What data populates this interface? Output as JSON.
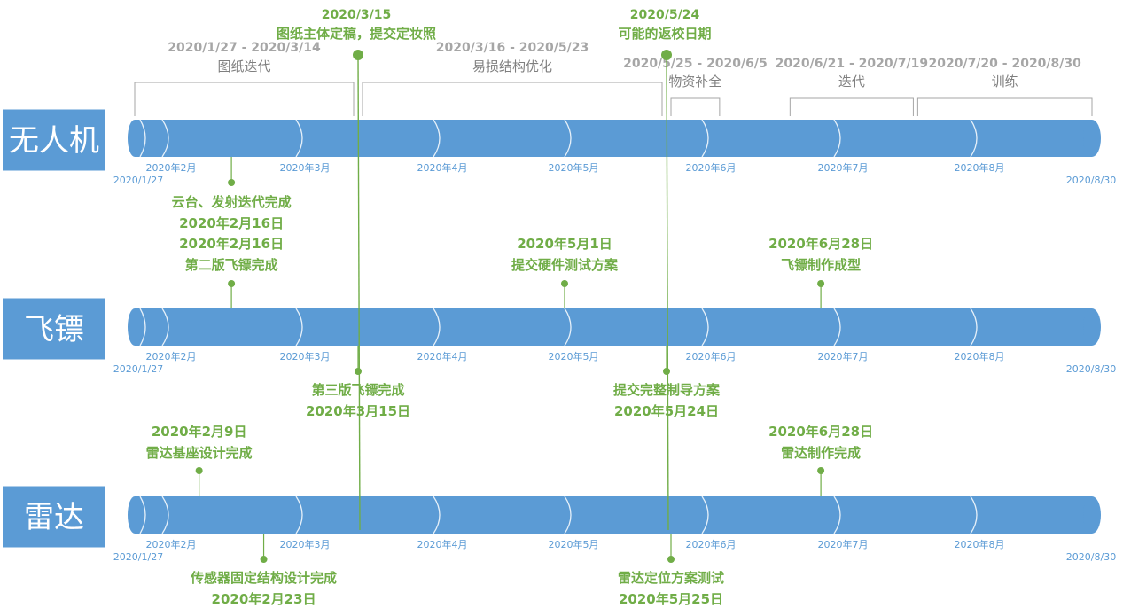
{
  "colors": {
    "bar": "#5b9bd5",
    "bar_edge": "#ffffff",
    "label_box": "#5b9bd5",
    "label_text": "#ffffff",
    "tick_text": "#5b9bd5",
    "milestone": "#70ad47",
    "milestone_text": "#70ad47",
    "phase_text": "#a6a6a6",
    "phase_bracket": "#a6a6a6",
    "phase_title": "#7f7f7f"
  },
  "timeline": {
    "start_label": "2020/1/27",
    "end_label": "2020/8/30",
    "month_labels": [
      "2020年2月",
      "2020年3月",
      "2020年4月",
      "2020年5月",
      "2020年6月",
      "2020年7月",
      "2020年8月"
    ]
  },
  "tracks": [
    {
      "id": "uav",
      "label": "无人机"
    },
    {
      "id": "dart",
      "label": "飞镖"
    },
    {
      "id": "radar",
      "label": "雷达"
    }
  ],
  "phases": [
    {
      "dates": "2020/1/27 - 2020/3/14",
      "name": "图纸迭代"
    },
    {
      "dates": "2020/3/16 - 2020/5/23",
      "name": "易损结构优化"
    },
    {
      "dates": "2020/5/25 - 2020/6/5",
      "name": "物资补全"
    },
    {
      "dates": "2020/6/21 - 2020/7/19",
      "name": "迭代"
    },
    {
      "dates": "2020/7/20 - 2020/8/30",
      "name": "训练"
    }
  ],
  "global_milestones": [
    {
      "date": "2020/3/15",
      "text": "图纸主体定稿，提交定妆照"
    },
    {
      "date": "2020/5/24",
      "text": "可能的返校日期"
    }
  ],
  "milestones": [
    {
      "track": "uav",
      "line1": "云台、发射迭代完成",
      "line2": "2020年2月16日"
    },
    {
      "track": "dart",
      "line1": "2020年2月16日",
      "line2": "第二版飞镖完成"
    },
    {
      "track": "dart",
      "line1": "2020年5月1日",
      "line2": "提交硬件测试方案"
    },
    {
      "track": "dart",
      "line1": "2020年6月28日",
      "line2": "飞镖制作成型"
    },
    {
      "track": "dart",
      "line1": "第三版飞镖完成",
      "line2": "2020年3月15日"
    },
    {
      "track": "dart",
      "line1": "提交完整制导方案",
      "line2": "2020年5月24日"
    },
    {
      "track": "radar",
      "line1": "2020年2月9日",
      "line2": "雷达基座设计完成"
    },
    {
      "track": "radar",
      "line1": "2020年6月28日",
      "line2": "雷达制作完成"
    },
    {
      "track": "radar",
      "line1": "传感器固定结构设计完成",
      "line2": "2020年2月23日"
    },
    {
      "track": "radar",
      "line1": "雷达定位方案测试",
      "line2": "2020年5月25日"
    }
  ]
}
